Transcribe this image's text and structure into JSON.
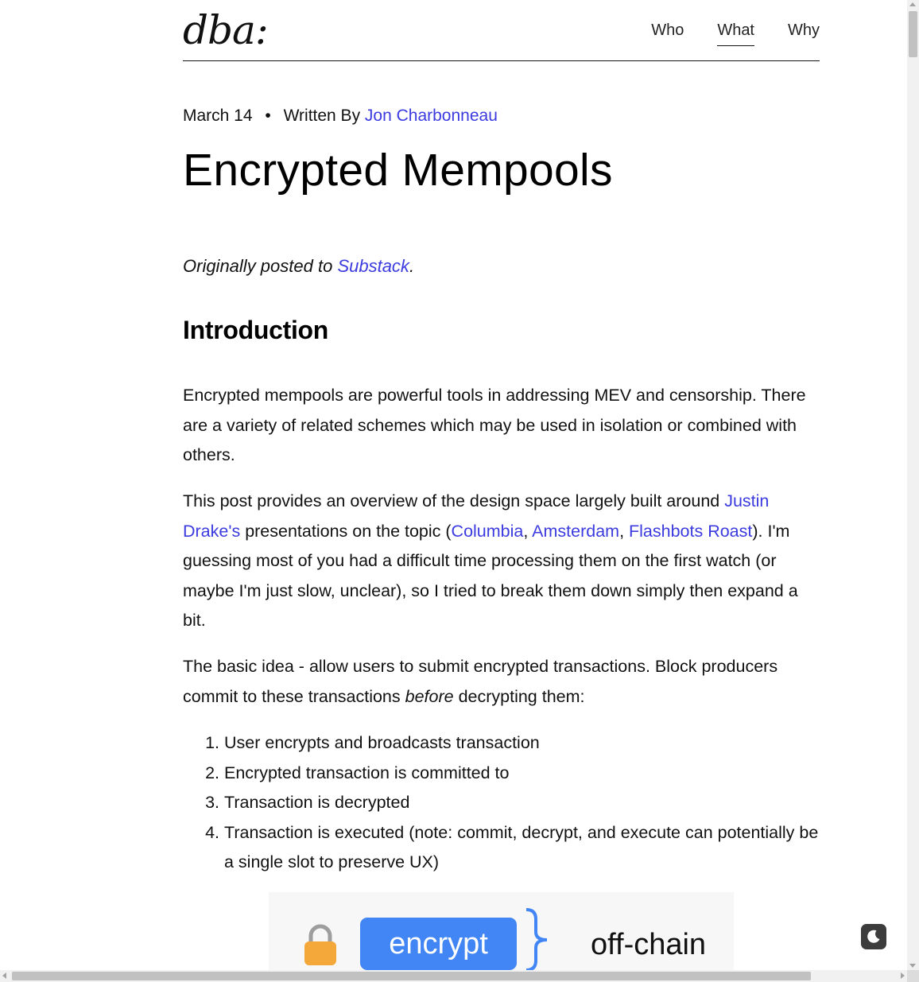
{
  "site": {
    "logo": "dba:",
    "nav": [
      {
        "label": "Who",
        "active": false
      },
      {
        "label": "What",
        "active": true
      },
      {
        "label": "Why",
        "active": false
      }
    ]
  },
  "post": {
    "date": "March 14",
    "separator": "•",
    "written_by": "Written By",
    "author": "Jon Charbonneau",
    "title": "Encrypted Mempools",
    "origin_prefix": "Originally posted to ",
    "origin_link": "Substack",
    "origin_suffix": ".",
    "section_heading": "Introduction",
    "p1": "Encrypted mempools are powerful tools in addressing MEV and censorship. There are a variety of related schemes which may be used in isolation or combined with others.",
    "p2": {
      "t1": "This post provides an overview of the design space largely built around ",
      "link1": "Justin Drake's",
      "t2": " presentations on the topic (",
      "link2": "Columbia",
      "t3": ", ",
      "link3": "Amsterdam",
      "t4": ", ",
      "link4": "Flashbots Roast",
      "t5": "). I'm guessing most of you had a difficult time processing them on the first watch (or maybe I'm just slow, unclear), so I tried to break them down simply then expand a bit."
    },
    "p3": {
      "t1": "The basic idea - allow users to submit encrypted transactions. Block producers commit to these transactions ",
      "em": "before",
      "t2": " decrypting them:"
    },
    "steps": [
      "User encrypts and broadcasts transaction",
      "Encrypted transaction is committed to",
      "Transaction is decrypted",
      "Transaction is executed (note: commit, decrypt, and execute can potentially be a single slot to preserve UX)"
    ],
    "figure": {
      "button_label": "encrypt",
      "side_label": "off-chain"
    }
  },
  "colors": {
    "link": "#3b3be0",
    "encrypt_button": "#4285f4",
    "lock_body": "#f4a83a",
    "lock_shackle": "#9e9e9e",
    "toggle_bg": "#3c3c3c"
  },
  "icons": {
    "lock": "lock-icon",
    "brace": "curly-brace-icon",
    "theme": "moon-icon"
  }
}
